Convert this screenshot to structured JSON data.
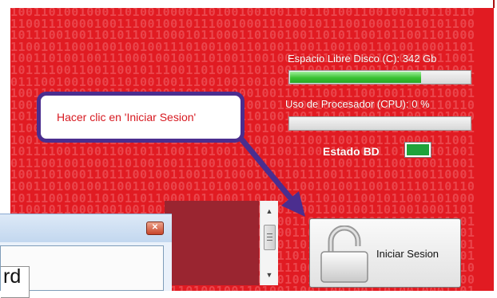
{
  "status": {
    "disk_label": "Espacio Libre Disco (C):  342 Gb",
    "disk_fill": 0.73,
    "cpu_label": "Uso de Procesador (CPU):  0 %",
    "cpu_fill": 0.0,
    "db_label": "Estado BD",
    "db_status_color": "#1fa33a"
  },
  "callout": {
    "text": "Hacer clic en 'Iniciar Sesion'"
  },
  "login": {
    "button_label": "Iniciar Sesion",
    "icon": "padlock-icon"
  },
  "window_fragment": {
    "partial_text": "rd",
    "close_icon": "close-icon"
  },
  "colors": {
    "background_red": "#e11b22",
    "callout_border": "#4b2e8f",
    "callout_text": "#d71920",
    "progress_green": "#39c233"
  }
}
